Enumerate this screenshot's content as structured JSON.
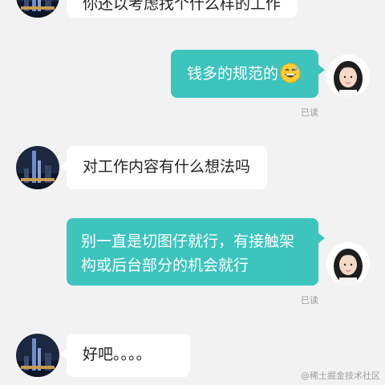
{
  "messages": [
    {
      "side": "in",
      "text": "你还以考虑找个什么样的工作"
    },
    {
      "side": "out",
      "text": "钱多的规范的",
      "emoji": "grinning-sweat-face",
      "status": "已读"
    },
    {
      "side": "in",
      "text": "对工作内容有什么想法吗"
    },
    {
      "side": "out",
      "text": "别一直是切图仔就行，有接触架构或后台部分的机会就行",
      "status": "已读"
    },
    {
      "side": "in",
      "text": "好吧。。。。"
    }
  ],
  "watermark": "@稀土掘金技术社区",
  "colors": {
    "background": "#f2f2f2",
    "outgoing_bubble": "#3cc4bd",
    "incoming_bubble": "#ffffff"
  }
}
